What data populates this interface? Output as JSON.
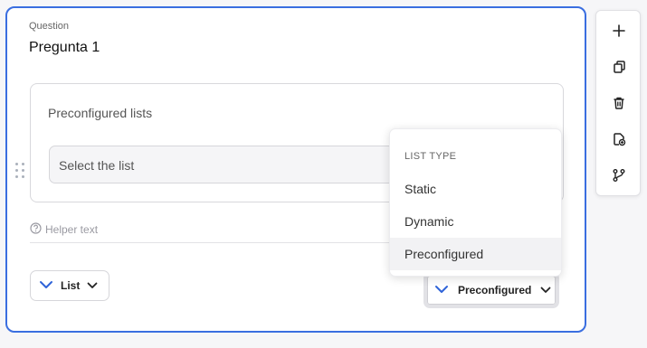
{
  "question": {
    "label": "Question",
    "title": "Pregunta 1"
  },
  "list_panel": {
    "label": "Preconfigured lists",
    "select_placeholder": "Select the list"
  },
  "helper_text": "Helper text",
  "list_type_button": {
    "label": "List",
    "icon": "chevron-down-icon"
  },
  "preconfigured_button": {
    "label": "Preconfigured",
    "icon": "chevron-down-icon"
  },
  "dropdown": {
    "header": "LIST TYPE",
    "options": [
      {
        "label": "Static"
      },
      {
        "label": "Dynamic"
      },
      {
        "label": "Preconfigured",
        "selected": true
      }
    ]
  },
  "toolbar": {
    "items": [
      "plus-icon",
      "copy-icon",
      "trash-icon",
      "add-page-icon",
      "branch-icon"
    ]
  },
  "colors": {
    "accent": "#3a6ee0",
    "chevron_blue": "#2f63d8",
    "border": "#d6d6da"
  }
}
